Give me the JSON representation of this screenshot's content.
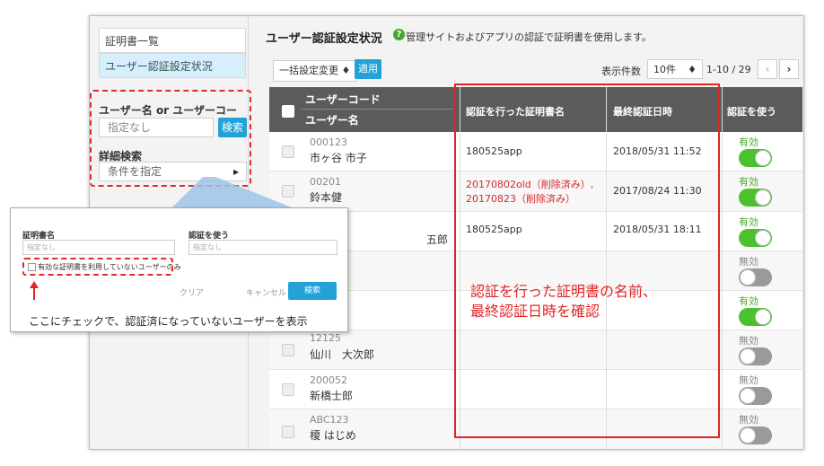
{
  "sidebar": {
    "items": [
      {
        "label": "証明書一覧"
      },
      {
        "label": "ユーザー認証設定状況"
      }
    ],
    "search_label": "ユーザー名 or ユーザーコード",
    "search_placeholder": "指定なし",
    "search_button": "検索",
    "detail_label": "詳細検索",
    "condition_label": "条件を指定",
    "condition_arrow": "▸"
  },
  "main": {
    "title": "ユーザー認証設定状況",
    "help_icon": "?",
    "description": "管理サイトおよびアプリの認証で証明書を使用します。",
    "bulk_change": "一括設定変更 ♦",
    "apply_button": "適用",
    "display_count_label": "表示件数",
    "display_count_value": "10件",
    "display_count_arrow": "♦",
    "range": "1-10 / 29",
    "prev": "‹",
    "next": "›"
  },
  "table": {
    "headers": {
      "user_code": "ユーザーコード",
      "user_name": "ユーザー名",
      "cert_name": "認証を行った証明書名",
      "last_auth": "最終認証日時",
      "use_auth": "認証を使う"
    },
    "rows": [
      {
        "code": "000123",
        "name": "市ヶ谷 市子",
        "cert": "180525app",
        "cert2": "",
        "date": "2018/05/31 11:52",
        "status": "有効",
        "on": true
      },
      {
        "code": "00201",
        "name": "鈴本健",
        "cert": "20170802old（削除済み）,",
        "cert2": "20170823（削除済み）",
        "date": "2017/08/24 11:30",
        "status": "有効",
        "on": true
      },
      {
        "code": "",
        "name": "五郎",
        "cert": "180525app",
        "cert2": "",
        "date": "2018/05/31 18:11",
        "status": "有効",
        "on": true
      },
      {
        "code": "",
        "name": "",
        "cert": "",
        "cert2": "",
        "date": "",
        "status": "無効",
        "on": false
      },
      {
        "code": "",
        "name": "",
        "cert": "",
        "cert2": "",
        "date": "",
        "status": "有効",
        "on": true
      },
      {
        "code": "12125",
        "name": "仙川　大次郎",
        "cert": "",
        "cert2": "",
        "date": "",
        "status": "無効",
        "on": false
      },
      {
        "code": "200052",
        "name": "新橋士郎",
        "cert": "",
        "cert2": "",
        "date": "",
        "status": "無効",
        "on": false
      },
      {
        "code": "ABC123",
        "name": "榎 はじめ",
        "cert": "",
        "cert2": "",
        "date": "",
        "status": "無効",
        "on": false
      }
    ]
  },
  "callout": {
    "line1": "認証を行った証明書の名前、",
    "line2": "最終認証日時を確認"
  },
  "popup": {
    "cert_label": "証明書名",
    "cert_placeholder": "指定なし",
    "use_label": "認証を使う",
    "use_placeholder": "指定なし",
    "checkbox_label": "有効な証明書を利用していないユーザーのみ",
    "clear_button": "クリア",
    "cancel_button": "キャンセル",
    "search_button": "検索",
    "annotation": "ここにチェックで、認証済になっていないユーザーを表示"
  },
  "colors": {
    "accent": "#23a2d8",
    "red": "#e22323",
    "green": "#4cc12f",
    "header": "#5b5b5b"
  }
}
